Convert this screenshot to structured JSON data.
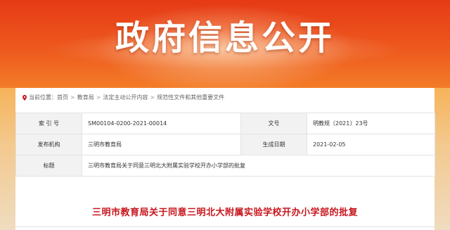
{
  "banner": {
    "title": "政府信息公开"
  },
  "breadcrumb": {
    "prefix": "当前位置：",
    "items": [
      "首页",
      "教育局",
      "法定主动公开内容",
      "规范性文件和其他重要文件"
    ],
    "separator": ">"
  },
  "info_table": {
    "index_label": "索 引 号",
    "index_value": "SM00104-0200-2021-00014",
    "docno_label": "文号",
    "docno_value": "明教规〔2021〕23号",
    "org_label": "发布机构",
    "org_value": "三明市教育局",
    "date_label": "生成日期",
    "date_value": "2021-02-05",
    "title_label": "标题",
    "title_value": "三明市教育局关于同意三明北大附属实验学校开办小学部的批复"
  },
  "document": {
    "title": "三明市教育局关于同意三明北大附属实验学校开办小学部的批复"
  },
  "colors": {
    "banner_top": "#e63a16",
    "banner_bottom": "#f1d6a8",
    "title_red": "#c8161d",
    "label_bg": "#f2f2f2"
  }
}
